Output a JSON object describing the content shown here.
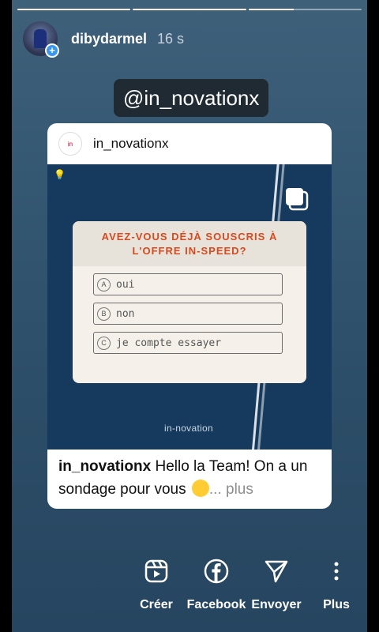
{
  "story": {
    "progress": [
      1,
      1,
      0.4
    ],
    "username": "dibydarmel",
    "time": "16 s",
    "mention": "@in_novationx"
  },
  "post": {
    "username": "in_novationx",
    "logo_text": "in",
    "brand": "in-novation",
    "poll": {
      "question": "AVEZ-VOUS DÉJÀ SOUSCRIS À L'OFFRE IN-SPEED?",
      "options": [
        {
          "letter": "A",
          "text": "oui"
        },
        {
          "letter": "B",
          "text": "non"
        },
        {
          "letter": "C",
          "text": "je compte essayer"
        }
      ]
    },
    "caption": {
      "username": "in_novationx",
      "text": " Hello la Team! On a un sondage pour vous ",
      "more": "... plus"
    }
  },
  "actions": [
    {
      "label": "Créer",
      "icon": "reels-icon"
    },
    {
      "label": "Facebook",
      "icon": "facebook-icon"
    },
    {
      "label": "Envoyer",
      "icon": "send-icon"
    },
    {
      "label": "Plus",
      "icon": "more-vertical-icon"
    }
  ]
}
